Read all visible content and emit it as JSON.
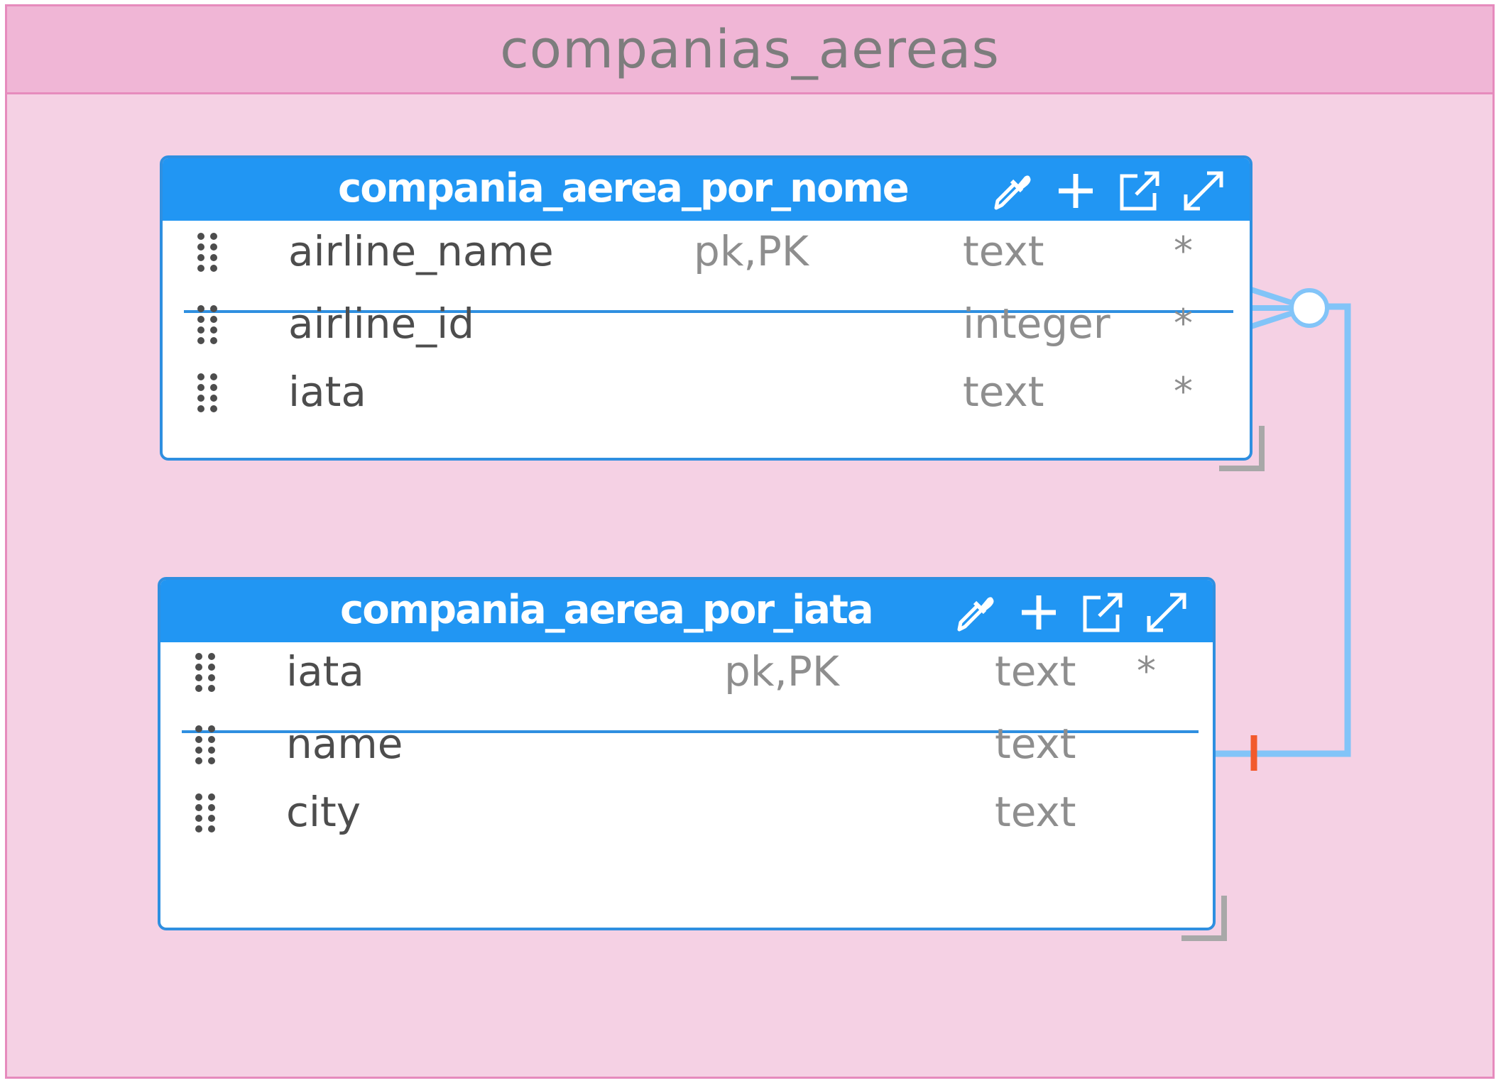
{
  "subject_area": {
    "title": "companias_aereas",
    "colors": {
      "frame": "#e68bbd",
      "header_bg": "#f0b6d6",
      "body_bg": "#f5d1e4"
    }
  },
  "entities": [
    {
      "title": "compania_aerea_por_nome",
      "icons": [
        "eyedropper-icon",
        "plus-icon",
        "external-link-icon",
        "expand-icon"
      ],
      "columns": [
        {
          "name": "airline_name",
          "key": "pk,PK",
          "type": "text",
          "required": "*"
        },
        {
          "name": "airline_id",
          "key": "",
          "type": "integer",
          "required": "*"
        },
        {
          "name": "iata",
          "key": "",
          "type": "text",
          "required": "*"
        }
      ]
    },
    {
      "title": "compania_aerea_por_iata",
      "icons": [
        "eyedropper-icon",
        "plus-icon",
        "external-link-icon",
        "expand-icon"
      ],
      "columns": [
        {
          "name": "iata",
          "key": "pk,PK",
          "type": "text",
          "required": "*"
        },
        {
          "name": "name",
          "key": "",
          "type": "text",
          "required": ""
        },
        {
          "name": "city",
          "key": "",
          "type": "text",
          "required": ""
        }
      ]
    }
  ],
  "relationship": {
    "from": "compania_aerea_por_iata",
    "to": "compania_aerea_por_nome",
    "parent_end": "one",
    "child_end": "zero-or-many",
    "colors": {
      "line": "#82c4f8",
      "one_marker": "#f25a2c"
    }
  },
  "colors": {
    "entity_header": "#2196f3",
    "entity_border": "#2f8fe0",
    "column_name": "#4d4d4d",
    "column_meta": "#8e8e8e"
  }
}
